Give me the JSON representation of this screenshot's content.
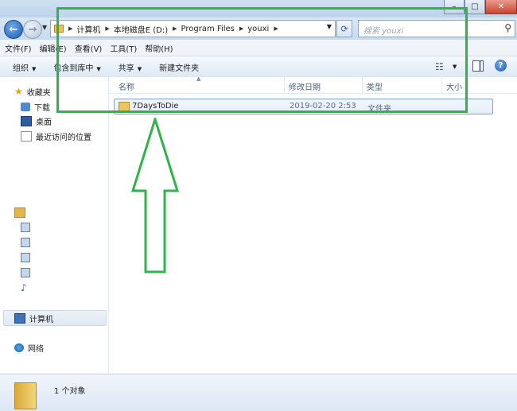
{
  "window": {
    "buttons": {
      "minimize": "–",
      "maximize": "□",
      "close": "✕"
    }
  },
  "address": {
    "breadcrumb": [
      "计算机",
      "本地磁盘E (D:)",
      "Program Files",
      "youxi"
    ],
    "search_placeholder": "搜索 youxi"
  },
  "menu": [
    "文件(F)",
    "编辑(E)",
    "查看(V)",
    "工具(T)",
    "帮助(H)"
  ],
  "toolbar": {
    "organize": "组织",
    "include_library": "包含到库中",
    "share": "共享",
    "new_folder": "新建文件夹"
  },
  "nav": {
    "favorites": "收藏夹",
    "downloads": "下载",
    "desktop": "桌面",
    "recent": "最近访问的位置",
    "computer": "计算机",
    "network": "网络"
  },
  "columns": {
    "name": "名称",
    "date": "修改日期",
    "type": "类型",
    "size": "大小"
  },
  "files": [
    {
      "name": "7DaysToDie",
      "date": "2019-02-20 2:53",
      "type": "文件夹"
    }
  ],
  "status": {
    "count": "1 个对象"
  },
  "colors": {
    "annotation_green": "#2fb34a",
    "selection_border": "#7da2ce"
  },
  "icons": {
    "back": "back-arrow-icon",
    "forward": "forward-arrow-icon",
    "refresh": "refresh-icon",
    "search": "search-icon",
    "folder": "folder-icon",
    "help": "help-icon"
  }
}
